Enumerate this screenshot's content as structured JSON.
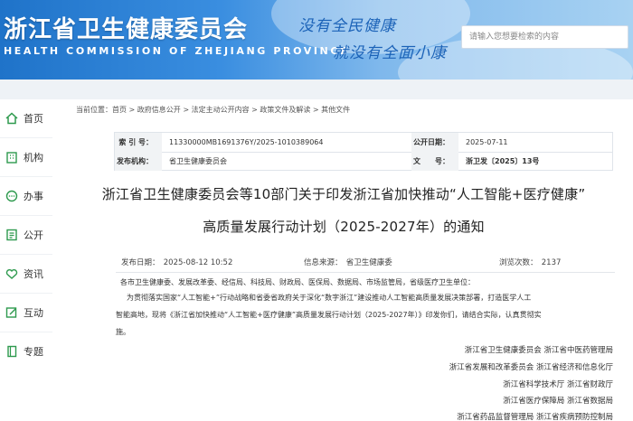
{
  "header": {
    "title": "浙江省卫生健康委员会",
    "subtitle": "HEALTH COMMISSION OF ZHEJIANG PROVINCE",
    "slogan_line1": "没有全民健康",
    "slogan_line2": "就没有全面小康",
    "search_placeholder": "请输入您想要检索的内容"
  },
  "sidebar": {
    "items": [
      {
        "label": "首页",
        "icon": "home-icon"
      },
      {
        "label": "机构",
        "icon": "building-icon"
      },
      {
        "label": "办事",
        "icon": "chat-icon"
      },
      {
        "label": "公开",
        "icon": "document-list-icon"
      },
      {
        "label": "资讯",
        "icon": "handshake-heart-icon"
      },
      {
        "label": "互动",
        "icon": "edit-icon"
      },
      {
        "label": "专题",
        "icon": "book-icon"
      }
    ]
  },
  "breadcrumb": "当前位置：首页 > 政府信息公开 > 法定主动公开内容 > 政策文件及解读 > 其他文件",
  "meta": {
    "index_label": "索 引 号：",
    "index_value": "11330000MB1691376Y/2025-1010389064",
    "publish_date_label": "公开日期：",
    "publish_date_value": "2025-07-11",
    "issuer_label": "发布机构：",
    "issuer_value": "省卫生健康委员会",
    "doc_no_label": "文　　号：",
    "doc_no_value": "浙卫发〔2025〕13号"
  },
  "document": {
    "title_line1": "浙江省卫生健康委员会等10部门关于印发浙江省加快推动“人工智能+医疗健康”",
    "title_line2": "高质量发展行动计划（2025-2027年）的通知",
    "publish_time": "发布日期：　2025-08-12 10:52",
    "source": "信息来源：　省卫生健康委",
    "views": "浏览次数：　2137",
    "recipients": "各市卫生健康委、发展改革委、经信局、科技局、财政局、医保局、数据局、市场监管局，省级医疗卫生单位：",
    "body_line1": "为贯彻落实国家“人工智能+”行动战略和省委省政府关于深化“数字浙江”建设推动人工智能高质量发展决策部署，打造医学人工",
    "body_line2": "智能高地，现将《浙江省加快推动“人工智能+医疗健康”高质量发展行动计划（2025-2027年）》印发你们，请结合实际，认真贯彻实",
    "body_line3": "施。",
    "signatories": [
      "浙江省卫生健康委员会 浙江省中医药管理局",
      "浙江省发展和改革委员会 浙江省经济和信息化厅",
      "浙江省科学技术厅 浙江省财政厅",
      "浙江省医疗保障局 浙江省数据局",
      "浙江省药品监督管理局 浙江省疾病预防控制局"
    ]
  },
  "colors": {
    "brand_blue": "#1f73c9",
    "slogan_blue": "#1c63b8",
    "icon_green": "#2e9a4e"
  }
}
